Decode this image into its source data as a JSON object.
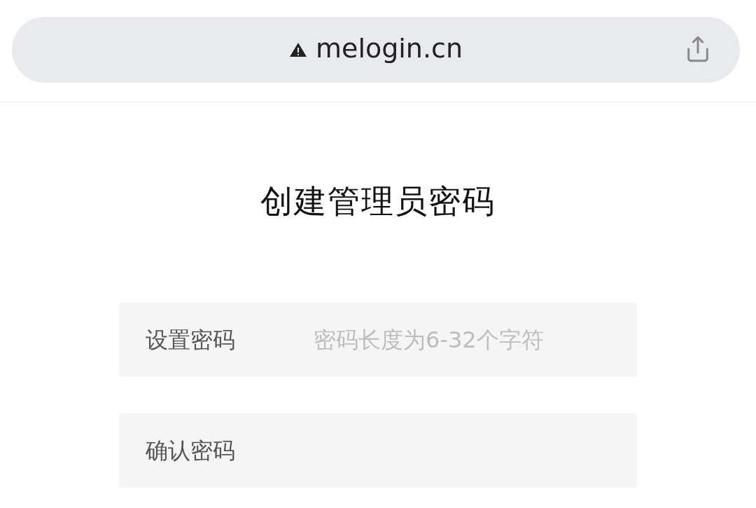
{
  "address_bar": {
    "url": "melogin.cn",
    "insecure": true
  },
  "title": "创建管理员密码",
  "fields": [
    {
      "label": "设置密码",
      "placeholder": "密码长度为6-32个字符"
    },
    {
      "label": "确认密码"
    }
  ]
}
